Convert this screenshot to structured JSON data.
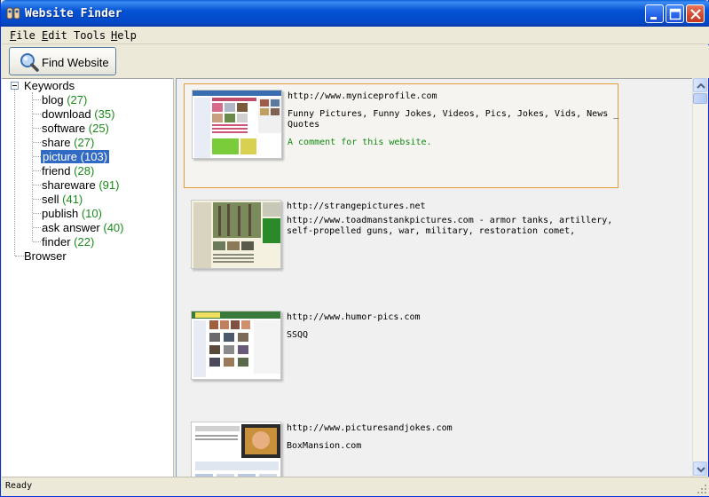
{
  "window": {
    "title": "Website Finder",
    "buttons": {
      "minimize": "minimize-icon",
      "maximize": "maximize-icon",
      "close": "close-icon"
    }
  },
  "menu": {
    "items": [
      {
        "first": "F",
        "rest": "ile"
      },
      {
        "first": "E",
        "rest": "dit"
      },
      {
        "first": "",
        "rest": "Tools"
      },
      {
        "first": "H",
        "rest": "elp"
      }
    ]
  },
  "toolbar": {
    "find_label": "Find Website",
    "find_icon": "magnifier-icon"
  },
  "tree": {
    "root_label": "Keywords",
    "keywords": [
      {
        "label": "blog",
        "count": "(27)"
      },
      {
        "label": "download",
        "count": "(35)"
      },
      {
        "label": "software",
        "count": "(25)"
      },
      {
        "label": "share",
        "count": "(27)"
      },
      {
        "label": "picture",
        "count": "(103)"
      },
      {
        "label": "friend",
        "count": "(28)"
      },
      {
        "label": "shareware",
        "count": "(91)"
      },
      {
        "label": "sell",
        "count": "(41)"
      },
      {
        "label": "publish",
        "count": "(10)"
      },
      {
        "label": "ask answer",
        "count": "(40)"
      },
      {
        "label": "finder",
        "count": "(22)"
      }
    ],
    "browser_label": "Browser",
    "selected_index": 4
  },
  "results": [
    {
      "url": "http://www.myniceprofile.com",
      "description": "Funny Pictures, Funny Jokes, Videos, Pics, Jokes, Vids, News _ Quotes",
      "comment": "A comment for this website."
    },
    {
      "url": "http://strangepictures.net",
      "description": "http://www.toadmanstankpictures.com - armor tanks, artillery, self-propelled guns, war, military, restoration comet,",
      "comment": ""
    },
    {
      "url": "http://www.humor-pics.com",
      "description": "SSQQ",
      "comment": ""
    },
    {
      "url": "http://www.picturesandjokes.com",
      "description": "BoxMansion.com",
      "comment": ""
    }
  ],
  "status": {
    "text": "Ready"
  },
  "colors": {
    "title_blue": "#0453d4",
    "selection": "#316ac5",
    "count_green": "#1a8a1a",
    "comment_green": "#118811",
    "card_border": "#e39e3a"
  }
}
